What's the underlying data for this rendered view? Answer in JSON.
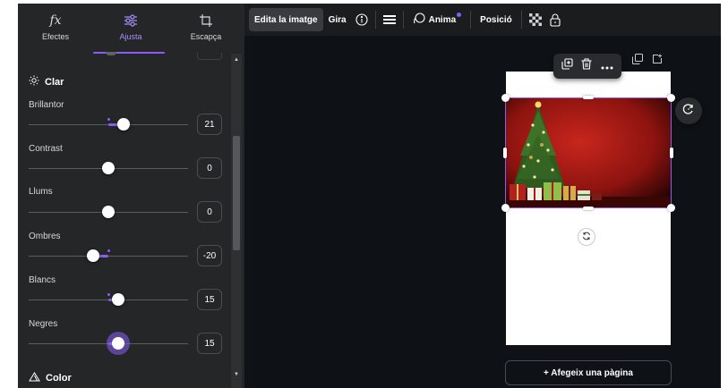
{
  "panel": {
    "tabs": [
      {
        "label": "Efectes",
        "icon": "fx-icon",
        "active": false
      },
      {
        "label": "Ajusta",
        "icon": "sliders-icon",
        "active": true
      },
      {
        "label": "Escapça",
        "icon": "crop-icon",
        "active": false
      }
    ],
    "section_light": "Clar",
    "section_color": "Color",
    "sliders": [
      {
        "label": "Brillantor",
        "value": "21"
      },
      {
        "label": "Contrast",
        "value": "0"
      },
      {
        "label": "Llums",
        "value": "0"
      },
      {
        "label": "Ombres",
        "value": "-20"
      },
      {
        "label": "Blancs",
        "value": "15"
      },
      {
        "label": "Negres",
        "value": "15"
      }
    ]
  },
  "toolbar": {
    "edit_image": "Edita la imatge",
    "rotate": "Gira",
    "animate": "Anima",
    "position": "Posició"
  },
  "canvas": {
    "add_page": "+ Afegeix una pàgina"
  },
  "colors": {
    "accent": "#8b5cf6",
    "panel_bg": "#252627",
    "canvas_bg": "#0e1116"
  }
}
